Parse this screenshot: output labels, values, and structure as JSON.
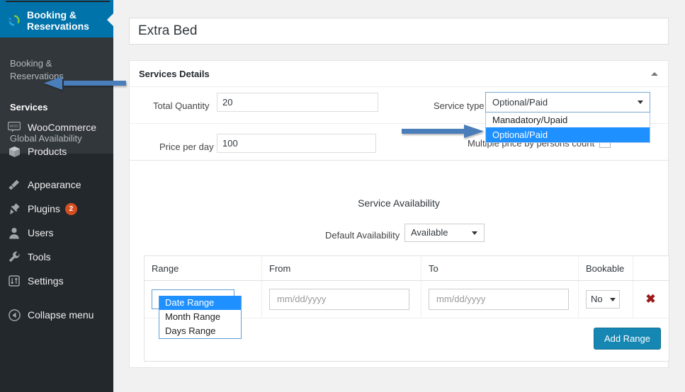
{
  "sidebar": {
    "current_menu": {
      "label": "Booking &\nReservations",
      "icon": "booking-refresh-icon"
    },
    "submenu": [
      {
        "label": "Booking &\nReservations",
        "active": false
      },
      {
        "label": "Services",
        "active": true
      },
      {
        "label": "Global Availability",
        "active": false
      }
    ],
    "items": [
      {
        "label": "WooCommerce",
        "icon": "woocommerce-icon",
        "badge": ""
      },
      {
        "label": "Products",
        "icon": "products-box-icon",
        "badge": ""
      },
      {
        "label": "Appearance",
        "icon": "appearance-brush-icon",
        "badge": ""
      },
      {
        "label": "Plugins",
        "icon": "plugins-plug-icon",
        "badge": "2"
      },
      {
        "label": "Users",
        "icon": "users-person-icon",
        "badge": ""
      },
      {
        "label": "Tools",
        "icon": "tools-wrench-icon",
        "badge": ""
      },
      {
        "label": "Settings",
        "icon": "settings-sliders-icon",
        "badge": ""
      }
    ],
    "collapse": {
      "label": "Collapse menu",
      "icon": "collapse-left-arrow-icon"
    }
  },
  "page": {
    "title": "Extra Bed"
  },
  "services_details": {
    "heading": "Services Details",
    "toggle_icon": "chevron-up-icon",
    "total_quantity": {
      "label": "Total Quantity",
      "value": "20"
    },
    "price_per_day": {
      "label": "Price per day",
      "value": "100"
    },
    "service_type": {
      "label": "Service type",
      "selected": "Optional/Paid",
      "open": true,
      "options": [
        {
          "label": "Manadatory/Upaid",
          "selected": false
        },
        {
          "label": "Optional/Paid",
          "selected": true
        }
      ]
    },
    "multiple_price": {
      "label": "Multiple price by persons count",
      "checked": false
    }
  },
  "service_availability": {
    "heading": "Service Availability",
    "default_availability": {
      "label": "Default Availability",
      "selected": "Available"
    },
    "table": {
      "columns": [
        "Range",
        "From",
        "To",
        "Bookable"
      ],
      "rows": [
        {
          "range": {
            "selected": "Date Range",
            "open": true,
            "options": [
              {
                "label": "Date Range",
                "selected": true
              },
              {
                "label": "Month Range",
                "selected": false
              },
              {
                "label": "Days Range",
                "selected": false
              }
            ]
          },
          "from_placeholder": "mm/dd/yyyy",
          "to_placeholder": "mm/dd/yyyy",
          "bookable": "No",
          "delete_icon": "delete-x-icon"
        }
      ]
    },
    "add_range_label": "Add Range"
  },
  "colors": {
    "wp_blue": "#0073aa",
    "sidebar_dark": "#23282d",
    "submenu_dark": "#32373c",
    "highlight_blue": "#1e90ff",
    "button_blue": "#1687b3",
    "badge_orange": "#d54e21",
    "annotation_arrow": "#4a7ebb"
  },
  "annotations": [
    {
      "name": "arrow-pointing-services",
      "target": "Services"
    },
    {
      "name": "arrow-pointing-service-type-dropdown",
      "target": "Service type dropdown"
    }
  ]
}
